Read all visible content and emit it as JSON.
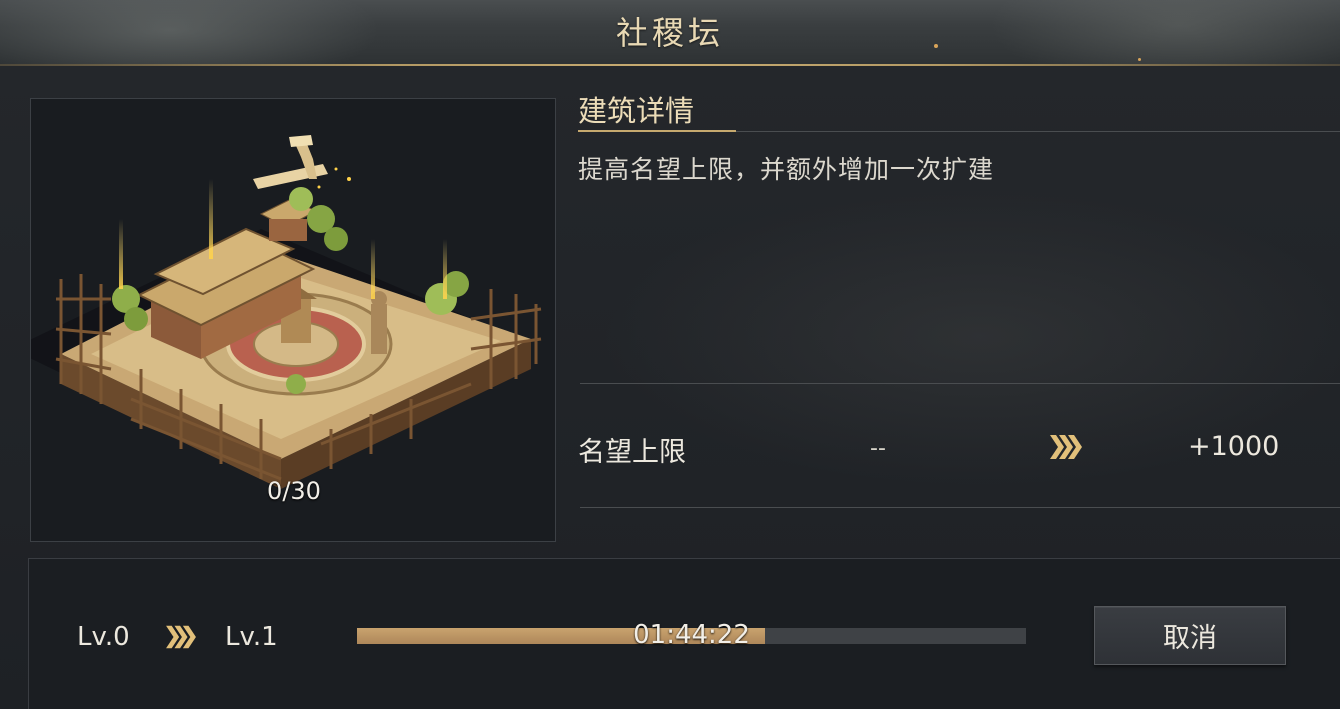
{
  "header": {
    "title": "社稷坛"
  },
  "building": {
    "progress_count": "0/30",
    "image_icon": "building-construction-illustration"
  },
  "details": {
    "section_title": "建筑详情",
    "description": "提高名望上限，并额外增加一次扩建",
    "stat": {
      "label": "名望上限",
      "current": "--",
      "next": "+1000",
      "arrow_icon": "triple-chevron-right-icon"
    }
  },
  "upgrade": {
    "level_from": "Lv.0",
    "level_to": "Lv.1",
    "timer": "01:44:22",
    "progress_fraction": 0.61,
    "cancel_label": "取消"
  },
  "colors": {
    "accent_gold": "#c6a96e",
    "progress_fill": "#c9a36e",
    "progress_track": "#3f4246",
    "background": "#1f2226"
  }
}
